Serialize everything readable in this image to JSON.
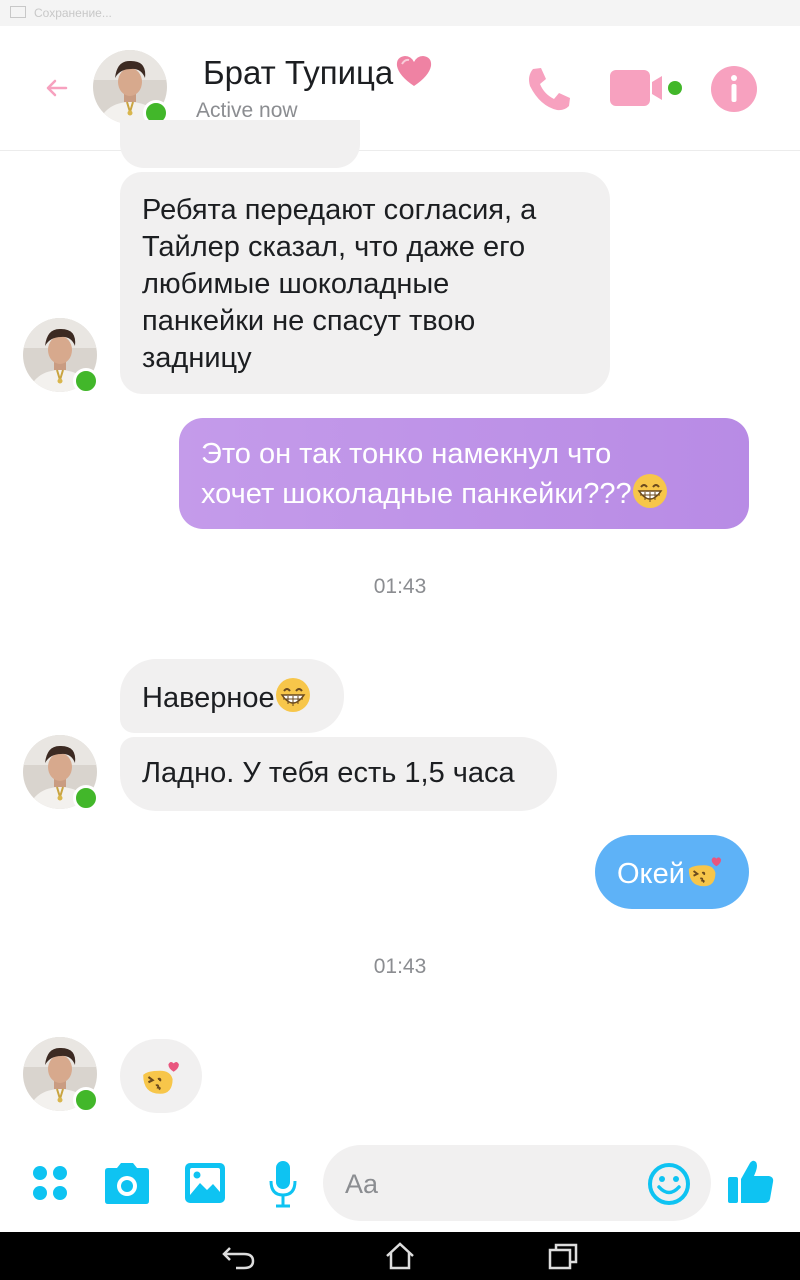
{
  "status_bar": {
    "notification": "Сохранение..."
  },
  "header": {
    "contact_name": "Брат Тупица",
    "status": "Active now",
    "icons": [
      "back-arrow-icon",
      "phone-icon",
      "video-camera-icon",
      "info-icon"
    ],
    "accent_color": "#f7a1bf"
  },
  "messages": [
    {
      "sender": "contact",
      "text": "Ребята передают согласия, а Тайлер сказал, что даже его любимые шоколадные панкейки не спасут твою задницу",
      "lines": [
        "Ребята передают согласия, а",
        "Тайлер сказал, что даже его",
        "любимые шоколадные",
        "панкейки не спасут твою",
        "задницу"
      ]
    },
    {
      "sender": "me",
      "text": "Это он так тонко намекнул что хочет шоколадные панкейки???😁",
      "lines": [
        "Это он так тонко намекнул что",
        "хочет шоколадные панкейки???"
      ]
    },
    {
      "type": "timestamp",
      "text": "01:43"
    },
    {
      "sender": "contact",
      "text": "Наверное😁"
    },
    {
      "sender": "contact",
      "text": "Ладно. У тебя есть 1,5 часа"
    },
    {
      "sender": "me",
      "text": "Окей😘"
    },
    {
      "type": "timestamp",
      "text": "01:43"
    },
    {
      "sender": "contact",
      "text": "😘"
    }
  ],
  "composer": {
    "placeholder": "Aa",
    "icons": [
      "more-icon",
      "camera-icon",
      "gallery-icon",
      "microphone-icon",
      "emoji-icon",
      "like-icon"
    ],
    "accent_color": "#0ec3f2"
  },
  "nav_bar": {
    "icons": [
      "nav-back-icon",
      "nav-home-icon",
      "nav-recents-icon"
    ]
  },
  "colors": {
    "incoming_bubble": "#f1f0f0",
    "outgoing_purple": "#c39ae9",
    "outgoing_blue": "#5eb2f7",
    "online_dot": "#42b72a"
  }
}
